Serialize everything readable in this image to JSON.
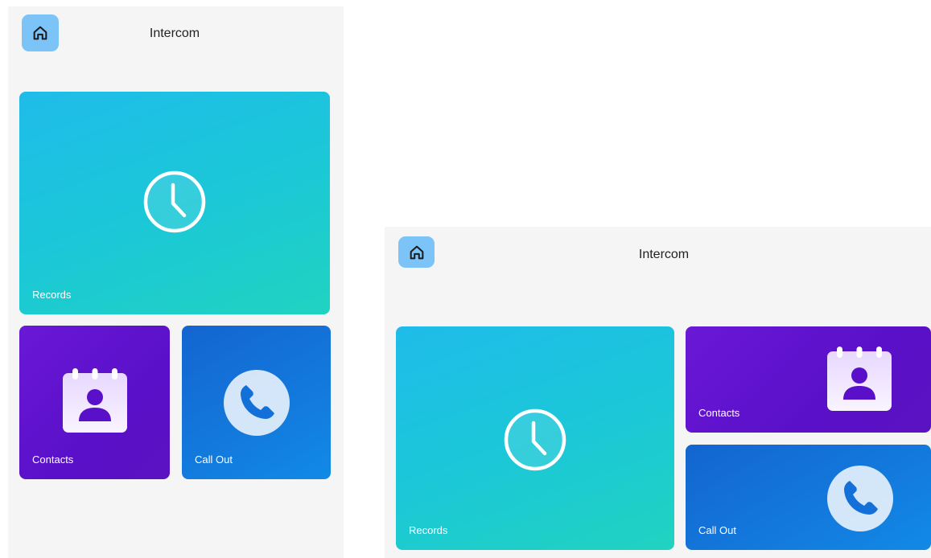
{
  "header": {
    "title": "Intercom",
    "home_icon": "home-icon"
  },
  "tiles": {
    "records": {
      "label": "Records",
      "icon": "clock-icon",
      "color": "#1bc8d6"
    },
    "contacts": {
      "label": "Contacts",
      "icon": "contact-card-icon",
      "color": "#5a10c8"
    },
    "callout": {
      "label": "Call Out",
      "icon": "phone-icon",
      "color": "#1378dc"
    }
  },
  "colors": {
    "screen_bg": "#f5f5f5",
    "home_button": "#7cc3f8"
  }
}
